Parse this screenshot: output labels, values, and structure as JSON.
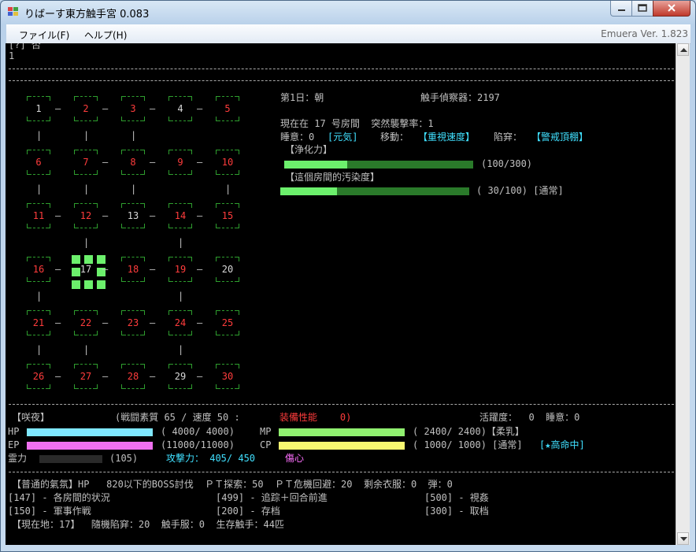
{
  "window": {
    "title": "りばーす東方触手宮 0.083",
    "version": "Emuera Ver. 1.823",
    "menu": [
      "ファイル(F)",
      "ヘルプ(H)"
    ],
    "controls": [
      "minimize-icon",
      "maximize-icon",
      "close-icon"
    ],
    "colors": {
      "close": "#c75050",
      "accent_green": "#6cf06c",
      "red": "#ff3c3c",
      "cyan": "#40e0ff"
    }
  },
  "console": {
    "top_partial": "[?] 否",
    "top_line2": "1",
    "status": {
      "day": "第1日：朝",
      "detector": "触手偵察器：2197",
      "location_line": "現在在 17 号房間  突然襲撃率：1",
      "sleep_prefix": "睡意：0",
      "sleep_state": "[元気]",
      "move_label": "移動：",
      "move_value": "【重視速度】",
      "trap_label": "陷穽：",
      "trap_value": "【警戒頂棚】",
      "purify_label": "【浄化力】",
      "purify_text": "(100/300)",
      "purify_fraction": 0.333,
      "pollution_label": "【這個房間的汚染度】",
      "pollution_text": "( 30/100) [通常]",
      "pollution_fraction": 0.3
    },
    "map": {
      "current_room": "17",
      "rooms": [
        {
          "n": "1",
          "c": "w"
        },
        {
          "n": "2",
          "c": "r"
        },
        {
          "n": "3",
          "c": "r"
        },
        {
          "n": "4",
          "c": "w"
        },
        {
          "n": "5",
          "c": "r"
        },
        {
          "n": "6",
          "c": "r"
        },
        {
          "n": "7",
          "c": "r"
        },
        {
          "n": "8",
          "c": "r"
        },
        {
          "n": "9",
          "c": "r"
        },
        {
          "n": "10",
          "c": "r"
        },
        {
          "n": "11",
          "c": "r"
        },
        {
          "n": "12",
          "c": "r"
        },
        {
          "n": "13",
          "c": "w"
        },
        {
          "n": "14",
          "c": "r"
        },
        {
          "n": "15",
          "c": "r"
        },
        {
          "n": "16",
          "c": "r"
        },
        {
          "n": "17",
          "c": "w"
        },
        {
          "n": "18",
          "c": "r"
        },
        {
          "n": "19",
          "c": "r"
        },
        {
          "n": "20",
          "c": "w"
        },
        {
          "n": "21",
          "c": "r"
        },
        {
          "n": "22",
          "c": "r"
        },
        {
          "n": "23",
          "c": "r"
        },
        {
          "n": "24",
          "c": "r"
        },
        {
          "n": "25",
          "c": "r"
        },
        {
          "n": "26",
          "c": "r"
        },
        {
          "n": "27",
          "c": "r"
        },
        {
          "n": "28",
          "c": "r"
        },
        {
          "n": "29",
          "c": "w"
        },
        {
          "n": "30",
          "c": "r"
        }
      ],
      "hlinks": [
        [
          1,
          1,
          1,
          1
        ],
        [
          0,
          1,
          1,
          1
        ],
        [
          1,
          1,
          1,
          1
        ],
        [
          1,
          1,
          1,
          1
        ],
        [
          1,
          1,
          1,
          1
        ],
        [
          1,
          1,
          1,
          1
        ]
      ],
      "vlinks": [
        [
          1,
          1,
          1,
          0,
          0
        ],
        [
          1,
          1,
          1,
          0,
          1
        ],
        [
          0,
          1,
          0,
          1,
          0
        ],
        [
          1,
          0,
          0,
          1,
          0
        ],
        [
          1,
          1,
          0,
          1,
          0
        ]
      ]
    },
    "char": {
      "name": "【咲夜】",
      "stats": "(戦闘素質 65 / 速度 50 :",
      "equip": "装備性能    0)",
      "activity": "活躍度：  0  睡意：0",
      "hp_label": "HP",
      "hp_text": "( 4000/ 4000)",
      "hp_fraction": 1.0,
      "mp_label": "MP",
      "mp_text": "( 2400/ 2400)【柔乳】",
      "mp_fraction": 1.0,
      "ep_label": "EP",
      "ep_text": "(11000/11000)",
      "ep_fraction": 1.0,
      "cp_label": "CP",
      "cp_text": "( 1000/ 1000) [通常]",
      "cp_fraction": 1.0,
      "cp_extra": "[★高命中]",
      "spirit_label": "霊力",
      "spirit_text": "(105)",
      "spirit_fraction": 0.0,
      "attack": "攻撃力： 405/ 450",
      "mood": "傷心"
    },
    "footer": {
      "line1": "【普通的氣氛】HP   820以下的BOSS討伐  ＰＴ探索：50  ＰＴ危機回避：20  剩余衣服：0  弾：0",
      "commands": [
        [
          "[147] - 各房間的状況",
          "[499] - 追踪＋回合前進",
          "[500] - 視姦"
        ],
        [
          "[150] - 軍事作戦",
          "[200] - 存档",
          "[300] - 取档"
        ]
      ],
      "line4": "【現在地：17】  隨機陷穽：20  触手服：0  生存触手：44匹"
    }
  }
}
